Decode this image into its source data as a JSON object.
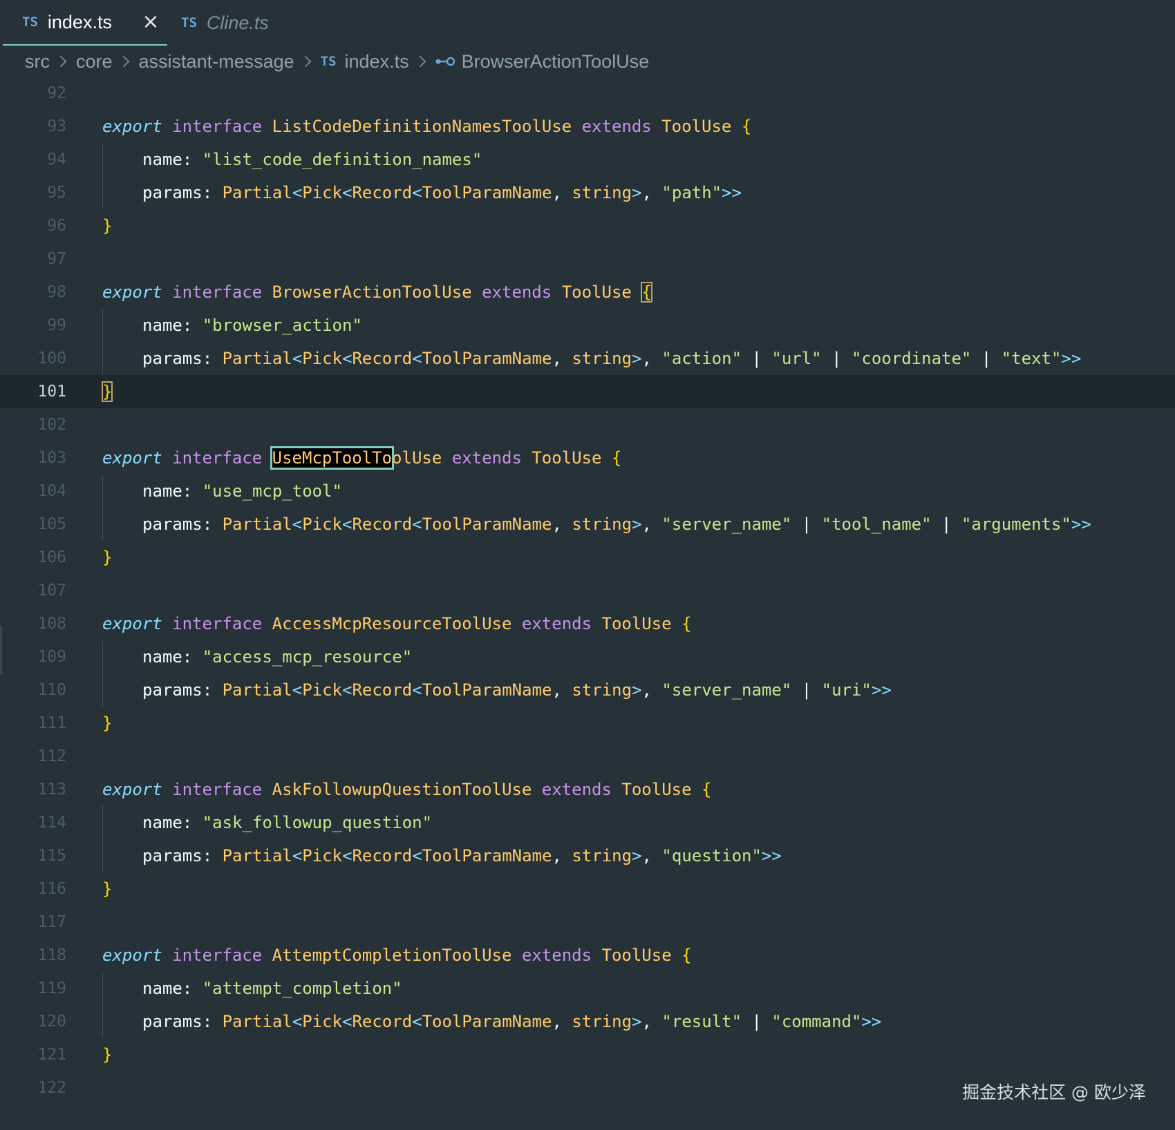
{
  "tabs": [
    {
      "badge": "TS",
      "label": "index.ts",
      "active": true,
      "close": "×"
    },
    {
      "badge": "TS",
      "label": "Cline.ts",
      "active": false
    }
  ],
  "breadcrumb": {
    "items": [
      "src",
      "core",
      "assistant-message"
    ],
    "file_badge": "TS",
    "file": "index.ts",
    "symbol_icon": "interface-symbol-icon",
    "symbol": "BrowserActionToolUse"
  },
  "editor": {
    "current_line": 101,
    "lines": [
      {
        "n": "92"
      },
      {
        "n": "93",
        "t": [
          [
            "kw",
            "export"
          ],
          [
            "pn",
            " "
          ],
          [
            "st",
            "interface"
          ],
          [
            "pn",
            " "
          ],
          [
            "tn",
            "ListCodeDefinitionNamesToolUse"
          ],
          [
            "pn",
            " "
          ],
          [
            "st",
            "extends"
          ],
          [
            "pn",
            " "
          ],
          [
            "tn",
            "ToolUse"
          ],
          [
            "pn",
            " "
          ],
          [
            "br",
            "{"
          ]
        ]
      },
      {
        "n": "94",
        "i": true,
        "t": [
          [
            "pr",
            "name: "
          ],
          [
            "str",
            "\"list_code_definition_names\""
          ]
        ]
      },
      {
        "n": "95",
        "i": true,
        "t": [
          [
            "pr",
            "params: "
          ],
          [
            "tn",
            "Partial"
          ],
          [
            "ab",
            "<"
          ],
          [
            "tn",
            "Pick"
          ],
          [
            "ab",
            "<"
          ],
          [
            "tn",
            "Record"
          ],
          [
            "ab",
            "<"
          ],
          [
            "tn",
            "ToolParamName"
          ],
          [
            "pn",
            ", "
          ],
          [
            "tn",
            "string"
          ],
          [
            "ab",
            ">"
          ],
          [
            "pn",
            ", "
          ],
          [
            "str",
            "\"path\""
          ],
          [
            "ab",
            ">>"
          ]
        ]
      },
      {
        "n": "96",
        "t": [
          [
            "br",
            "}"
          ]
        ]
      },
      {
        "n": "97"
      },
      {
        "n": "98",
        "t": [
          [
            "kw",
            "export"
          ],
          [
            "pn",
            " "
          ],
          [
            "st",
            "interface"
          ],
          [
            "pn",
            " "
          ],
          [
            "tn",
            "BrowserActionToolUse"
          ],
          [
            "pn",
            " "
          ],
          [
            "st",
            "extends"
          ],
          [
            "pn",
            " "
          ],
          [
            "tn",
            "ToolUse"
          ],
          [
            "pn",
            " "
          ],
          [
            "br",
            "{",
            "m"
          ]
        ]
      },
      {
        "n": "99",
        "i": true,
        "t": [
          [
            "pr",
            "name: "
          ],
          [
            "str",
            "\"browser_action\""
          ]
        ]
      },
      {
        "n": "100",
        "i": true,
        "t": [
          [
            "pr",
            "params: "
          ],
          [
            "tn",
            "Partial"
          ],
          [
            "ab",
            "<"
          ],
          [
            "tn",
            "Pick"
          ],
          [
            "ab",
            "<"
          ],
          [
            "tn",
            "Record"
          ],
          [
            "ab",
            "<"
          ],
          [
            "tn",
            "ToolParamName"
          ],
          [
            "pn",
            ", "
          ],
          [
            "tn",
            "string"
          ],
          [
            "ab",
            ">"
          ],
          [
            "pn",
            ", "
          ],
          [
            "str",
            "\"action\""
          ],
          [
            "pn",
            " | "
          ],
          [
            "str",
            "\"url\""
          ],
          [
            "pn",
            " | "
          ],
          [
            "str",
            "\"coordinate\""
          ],
          [
            "pn",
            " | "
          ],
          [
            "str",
            "\"text\""
          ],
          [
            "ab",
            ">>"
          ]
        ]
      },
      {
        "n": "101",
        "t": [
          [
            "br",
            "}",
            "m"
          ]
        ]
      },
      {
        "n": "102"
      },
      {
        "n": "103",
        "t": [
          [
            "kw",
            "export"
          ],
          [
            "pn",
            " "
          ],
          [
            "st",
            "interface"
          ],
          [
            "pn",
            " "
          ],
          [
            "tn",
            "UseMcpToolTo",
            "f"
          ],
          [
            "tn",
            "olUse"
          ],
          [
            "pn",
            " "
          ],
          [
            "st",
            "extends"
          ],
          [
            "pn",
            " "
          ],
          [
            "tn",
            "ToolUse"
          ],
          [
            "pn",
            " "
          ],
          [
            "br",
            "{"
          ]
        ]
      },
      {
        "n": "104",
        "i": true,
        "t": [
          [
            "pr",
            "name: "
          ],
          [
            "str",
            "\"use_mcp_tool\""
          ]
        ]
      },
      {
        "n": "105",
        "i": true,
        "t": [
          [
            "pr",
            "params: "
          ],
          [
            "tn",
            "Partial"
          ],
          [
            "ab",
            "<"
          ],
          [
            "tn",
            "Pick"
          ],
          [
            "ab",
            "<"
          ],
          [
            "tn",
            "Record"
          ],
          [
            "ab",
            "<"
          ],
          [
            "tn",
            "ToolParamName"
          ],
          [
            "pn",
            ", "
          ],
          [
            "tn",
            "string"
          ],
          [
            "ab",
            ">"
          ],
          [
            "pn",
            ", "
          ],
          [
            "str",
            "\"server_name\""
          ],
          [
            "pn",
            " | "
          ],
          [
            "str",
            "\"tool_name\""
          ],
          [
            "pn",
            " | "
          ],
          [
            "str",
            "\"arguments\""
          ],
          [
            "ab",
            ">>"
          ]
        ]
      },
      {
        "n": "106",
        "t": [
          [
            "br",
            "}"
          ]
        ]
      },
      {
        "n": "107"
      },
      {
        "n": "108",
        "t": [
          [
            "kw",
            "export"
          ],
          [
            "pn",
            " "
          ],
          [
            "st",
            "interface"
          ],
          [
            "pn",
            " "
          ],
          [
            "tn",
            "AccessMcpResourceToolUse"
          ],
          [
            "pn",
            " "
          ],
          [
            "st",
            "extends"
          ],
          [
            "pn",
            " "
          ],
          [
            "tn",
            "ToolUse"
          ],
          [
            "pn",
            " "
          ],
          [
            "br",
            "{"
          ]
        ]
      },
      {
        "n": "109",
        "i": true,
        "t": [
          [
            "pr",
            "name: "
          ],
          [
            "str",
            "\"access_mcp_resource\""
          ]
        ]
      },
      {
        "n": "110",
        "i": true,
        "t": [
          [
            "pr",
            "params: "
          ],
          [
            "tn",
            "Partial"
          ],
          [
            "ab",
            "<"
          ],
          [
            "tn",
            "Pick"
          ],
          [
            "ab",
            "<"
          ],
          [
            "tn",
            "Record"
          ],
          [
            "ab",
            "<"
          ],
          [
            "tn",
            "ToolParamName"
          ],
          [
            "pn",
            ", "
          ],
          [
            "tn",
            "string"
          ],
          [
            "ab",
            ">"
          ],
          [
            "pn",
            ", "
          ],
          [
            "str",
            "\"server_name\""
          ],
          [
            "pn",
            " | "
          ],
          [
            "str",
            "\"uri\""
          ],
          [
            "ab",
            ">>"
          ]
        ]
      },
      {
        "n": "111",
        "t": [
          [
            "br",
            "}"
          ]
        ]
      },
      {
        "n": "112"
      },
      {
        "n": "113",
        "t": [
          [
            "kw",
            "export"
          ],
          [
            "pn",
            " "
          ],
          [
            "st",
            "interface"
          ],
          [
            "pn",
            " "
          ],
          [
            "tn",
            "AskFollowupQuestionToolUse"
          ],
          [
            "pn",
            " "
          ],
          [
            "st",
            "extends"
          ],
          [
            "pn",
            " "
          ],
          [
            "tn",
            "ToolUse"
          ],
          [
            "pn",
            " "
          ],
          [
            "br",
            "{"
          ]
        ]
      },
      {
        "n": "114",
        "i": true,
        "t": [
          [
            "pr",
            "name: "
          ],
          [
            "str",
            "\"ask_followup_question\""
          ]
        ]
      },
      {
        "n": "115",
        "i": true,
        "t": [
          [
            "pr",
            "params: "
          ],
          [
            "tn",
            "Partial"
          ],
          [
            "ab",
            "<"
          ],
          [
            "tn",
            "Pick"
          ],
          [
            "ab",
            "<"
          ],
          [
            "tn",
            "Record"
          ],
          [
            "ab",
            "<"
          ],
          [
            "tn",
            "ToolParamName"
          ],
          [
            "pn",
            ", "
          ],
          [
            "tn",
            "string"
          ],
          [
            "ab",
            ">"
          ],
          [
            "pn",
            ", "
          ],
          [
            "str",
            "\"question\""
          ],
          [
            "ab",
            ">>"
          ]
        ]
      },
      {
        "n": "116",
        "t": [
          [
            "br",
            "}"
          ]
        ]
      },
      {
        "n": "117"
      },
      {
        "n": "118",
        "t": [
          [
            "kw",
            "export"
          ],
          [
            "pn",
            " "
          ],
          [
            "st",
            "interface"
          ],
          [
            "pn",
            " "
          ],
          [
            "tn",
            "AttemptCompletionToolUse"
          ],
          [
            "pn",
            " "
          ],
          [
            "st",
            "extends"
          ],
          [
            "pn",
            " "
          ],
          [
            "tn",
            "ToolUse"
          ],
          [
            "pn",
            " "
          ],
          [
            "br",
            "{"
          ]
        ]
      },
      {
        "n": "119",
        "i": true,
        "t": [
          [
            "pr",
            "name: "
          ],
          [
            "str",
            "\"attempt_completion\""
          ]
        ]
      },
      {
        "n": "120",
        "i": true,
        "t": [
          [
            "pr",
            "params: "
          ],
          [
            "tn",
            "Partial"
          ],
          [
            "ab",
            "<"
          ],
          [
            "tn",
            "Pick"
          ],
          [
            "ab",
            "<"
          ],
          [
            "tn",
            "Record"
          ],
          [
            "ab",
            "<"
          ],
          [
            "tn",
            "ToolParamName"
          ],
          [
            "pn",
            ", "
          ],
          [
            "tn",
            "string"
          ],
          [
            "ab",
            ">"
          ],
          [
            "pn",
            ", "
          ],
          [
            "str",
            "\"result\""
          ],
          [
            "pn",
            " | "
          ],
          [
            "str",
            "\"command\""
          ],
          [
            "ab",
            ">>"
          ]
        ]
      },
      {
        "n": "121",
        "t": [
          [
            "br",
            "}"
          ]
        ]
      },
      {
        "n": "122"
      }
    ]
  },
  "watermark": "掘金技术社区 @ 欧少泽",
  "colors": {
    "background": "#263138",
    "keyword": "#89ddff",
    "storage": "#c792ea",
    "type": "#ffcb6b",
    "string": "#c3e88d",
    "tab_indicator": "#80cbc4"
  }
}
